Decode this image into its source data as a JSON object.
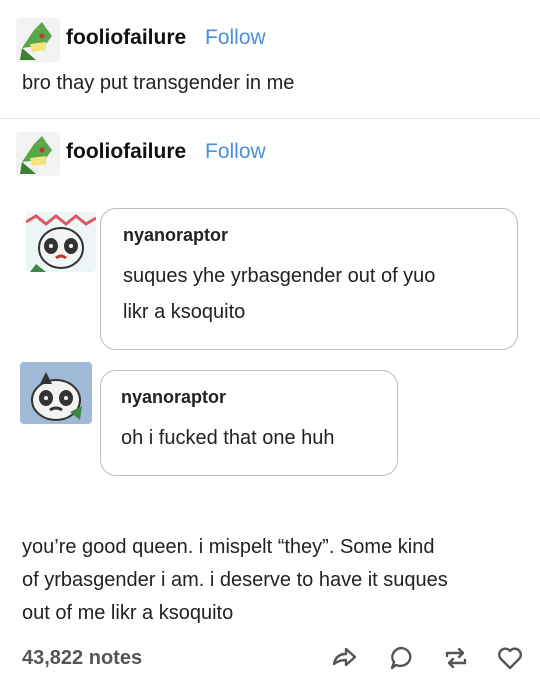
{
  "post1": {
    "username": "fooliofailure",
    "follow_label": "Follow",
    "text": "bro thay put transgender in me"
  },
  "post2": {
    "username": "fooliofailure",
    "follow_label": "Follow"
  },
  "replies": [
    {
      "username": "nyanoraptor",
      "lines": [
        "suques yhe yrbasgender out of yuo",
        "likr a ksoquito"
      ]
    },
    {
      "username": "nyanoraptor",
      "lines": [
        "oh i fucked that one huh"
      ]
    }
  ],
  "final_text": {
    "lines": [
      "you’re good queen. i mispelt “they”. Some kind",
      "of yrbasgender i am. i deserve to have it suques",
      "out of me likr a ksoquito"
    ]
  },
  "footer": {
    "notes": "43,822 notes",
    "icons": [
      "share-icon",
      "reply-icon",
      "reblog-icon",
      "like-icon"
    ]
  },
  "colors": {
    "follow": "#4a8fe0",
    "bubble_border": "#bdbdbd"
  }
}
